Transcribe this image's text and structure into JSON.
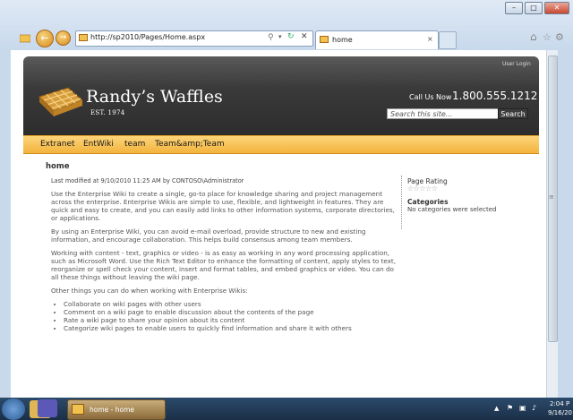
{
  "browser": {
    "address": "http://sp2010/Pages/Home.aspx",
    "tab_title": "home"
  },
  "site": {
    "user_login": "User Login",
    "logo_title": "Randy’s Waffles",
    "logo_subtitle": "EST. 1974",
    "call_label": "Call Us Now",
    "phone": "1.800.555.1212",
    "search_placeholder": "Search this site...",
    "search_button": "Search",
    "nav": [
      "Extranet",
      "EntWiki",
      "team",
      "Team&amp;Team"
    ]
  },
  "page": {
    "title": "home",
    "modified": "Last modified at 9/10/2010 11:25 AM by CONTOSO\\Administrator",
    "paragraphs": [
      "Use the Enterprise Wiki to create a single, go-to place for knowledge sharing and project management across the enterprise. Enterprise Wikis are simple to use, flexible, and lightweight in features. They are quick and easy to create, and you can easily add links to other information systems, corporate directories, or applications.",
      "By using an Enterprise Wiki, you can avoid e-mail overload, provide structure to new and existing information, and encourage collaboration. This helps build consensus among team members.",
      "Working with content - text, graphics or video - is as easy as working in any word processing application, such as Microsoft Word. Use the Rich Text Editor to enhance the formatting of content, apply styles to text, reorganize or spell check your content, insert and format tables, and embed graphics or video. You can do all these things without leaving the wiki page.",
      "Other things you can do when working with Enterprise Wikis:"
    ],
    "bullets": [
      "Collaborate on wiki pages with other users",
      "Comment on a wiki page to enable discussion about the contents of the page",
      "Rate a wiki page to share your opinion about its content",
      "Categorize wiki pages to enable users to quickly find information and share it with others"
    ],
    "rating_label": "Page Rating",
    "categories_label": "Categories",
    "categories_value": "No categories were selected"
  },
  "taskbar": {
    "active_window": "home - home",
    "time": "2:04 P",
    "date": "9/16/20"
  }
}
